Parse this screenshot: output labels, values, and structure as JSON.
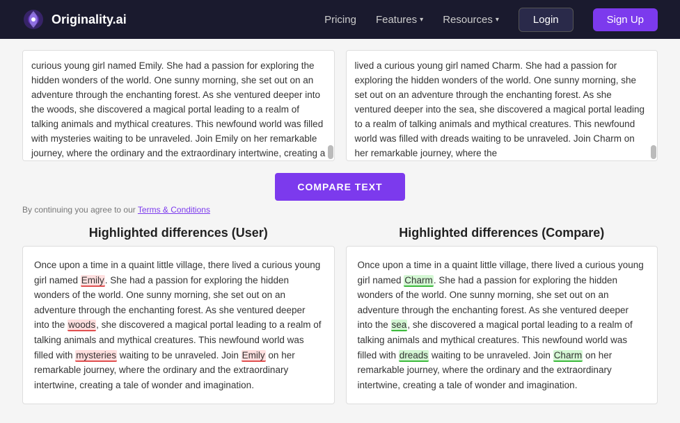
{
  "nav": {
    "logo_text": "Originality.ai",
    "links": [
      {
        "label": "Pricing",
        "has_chevron": false
      },
      {
        "label": "Features",
        "has_chevron": true
      },
      {
        "label": "Resources",
        "has_chevron": true
      }
    ],
    "login_label": "Login",
    "signup_label": "Sign Up"
  },
  "textareas": {
    "left_text": "curious young girl named Emily. She had a passion for exploring the hidden wonders of the world. One sunny morning, she set out on an adventure through the enchanting forest. As she ventured deeper into the woods, she discovered a magical portal leading to a realm of talking animals and mythical creatures. This newfound world was filled with mysteries waiting to be unraveled. Join Emily on her remarkable journey, where the ordinary and the extraordinary intertwine, creating a tale of wonder and",
    "right_text": "lived a curious young girl named Charm. She had a passion for exploring the hidden wonders of the world. One sunny morning, she set out on an adventure through the enchanting forest. As she ventured deeper into the sea, she discovered a magical portal leading to a realm of talking animals and mythical creatures. This newfound world was filled with dreads waiting to be unraveled. Join Charm on her remarkable journey, where the"
  },
  "compare_button_label": "COMPARE TEXT",
  "terms_text": "By continuing you agree to our",
  "terms_link_text": "Terms & Conditions",
  "diff_left_title": "Highlighted differences (User)",
  "diff_right_title": "Highlighted differences (Compare)",
  "diff_left_text_parts": [
    {
      "text": "Once upon a time in a quaint little village, there lived a curious young girl named ",
      "highlight": null
    },
    {
      "text": "Emily",
      "highlight": "red"
    },
    {
      "text": ". She had a passion for exploring the hidden wonders of the world. One sunny morning, she set out on an adventure through the enchanting forest. As she ventured deeper into the ",
      "highlight": null
    },
    {
      "text": "woods",
      "highlight": "red"
    },
    {
      "text": ", she discovered a magical portal leading to a realm of talking animals and mythical creatures. This newfound world was filled with ",
      "highlight": null
    },
    {
      "text": "mysteries",
      "highlight": "red"
    },
    {
      "text": " waiting to be unraveled. Join ",
      "highlight": null
    },
    {
      "text": "Emily",
      "highlight": "red"
    },
    {
      "text": " on her remarkable journey, where the ordinary and the extraordinary intertwine, creating a tale of wonder and imagination.",
      "highlight": null
    }
  ],
  "diff_right_text_parts": [
    {
      "text": "Once upon a time in a quaint little village, there lived a curious young girl named ",
      "highlight": null
    },
    {
      "text": "Charm",
      "highlight": "green"
    },
    {
      "text": ". She had a passion for exploring the hidden wonders of the world. One sunny morning, she set out on an adventure through the enchanting forest. As she ventured deeper into the ",
      "highlight": null
    },
    {
      "text": "sea",
      "highlight": "green"
    },
    {
      "text": ", she discovered a magical portal leading to a realm of talking animals and mythical creatures. This newfound world was filled with ",
      "highlight": null
    },
    {
      "text": "dreads",
      "highlight": "green"
    },
    {
      "text": " waiting to be unraveled. Join ",
      "highlight": null
    },
    {
      "text": "Charm",
      "highlight": "green"
    },
    {
      "text": " on her remarkable journey, where the ordinary and the extraordinary intertwine, creating a tale of wonder and imagination.",
      "highlight": null
    }
  ]
}
